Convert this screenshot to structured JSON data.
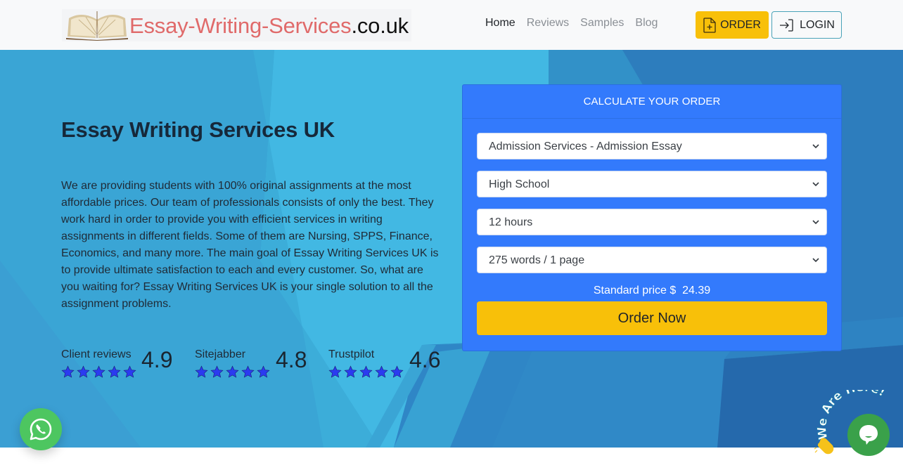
{
  "header": {
    "logo": {
      "main_text": "Essay-Writing-Services",
      "tld_text": ".co.uk",
      "icon": "open-book-icon"
    },
    "nav": [
      {
        "label": "Home",
        "active": true
      },
      {
        "label": "Reviews",
        "active": false
      },
      {
        "label": "Samples",
        "active": false
      },
      {
        "label": "Blog",
        "active": false
      }
    ],
    "order_button": {
      "label": "ORDER",
      "icon": "file-plus-icon"
    },
    "login_button": {
      "label": "LOGIN",
      "icon": "login-arrow-icon"
    }
  },
  "hero": {
    "title": "Essay Writing Services UK",
    "description": "We are providing students with 100% original assignments at the most affordable prices. Our team of professionals consists of only the best. They work hard in order to provide you with efficient services in writing assignments in different fields. Some of them are Nursing, SPPS, Finance, Economics, and many more. The main goal of Essay Writing Services UK is to provide ultimate satisfaction to each and every customer. So, what are you waiting for? Essay Writing Services UK is your single solution to all the assignment problems.",
    "ratings": [
      {
        "source": "Client reviews",
        "score": "4.9",
        "stars": 5
      },
      {
        "source": "Sitejabber",
        "score": "4.8",
        "stars": 5
      },
      {
        "source": "Trustpilot",
        "score": "4.6",
        "stars": 5
      }
    ]
  },
  "calculator": {
    "title": "CALCULATE YOUR ORDER",
    "selects": [
      {
        "name": "service",
        "value": "Admission Services - Admission Essay"
      },
      {
        "name": "academic-level",
        "value": "High School"
      },
      {
        "name": "deadline",
        "value": "12 hours"
      },
      {
        "name": "pages",
        "value": "275 words / 1 page"
      }
    ],
    "price_label": "Standard price $",
    "price_value": "24.39",
    "order_now_label": "Order Now"
  },
  "widgets": {
    "whatsapp": {
      "icon": "whatsapp-icon"
    },
    "chat": {
      "caption": "We Are Here!",
      "icon": "chat-bubble-icon",
      "wave_icon": "waving-hand-icon"
    }
  },
  "colors": {
    "accent_yellow": "#f8c009",
    "calculator_blue": "#337afc",
    "star_blue": "#2b3bf0",
    "logo_red": "#e06a6a",
    "whatsapp_green": "#4dc660",
    "chat_green": "#3aa14a"
  }
}
